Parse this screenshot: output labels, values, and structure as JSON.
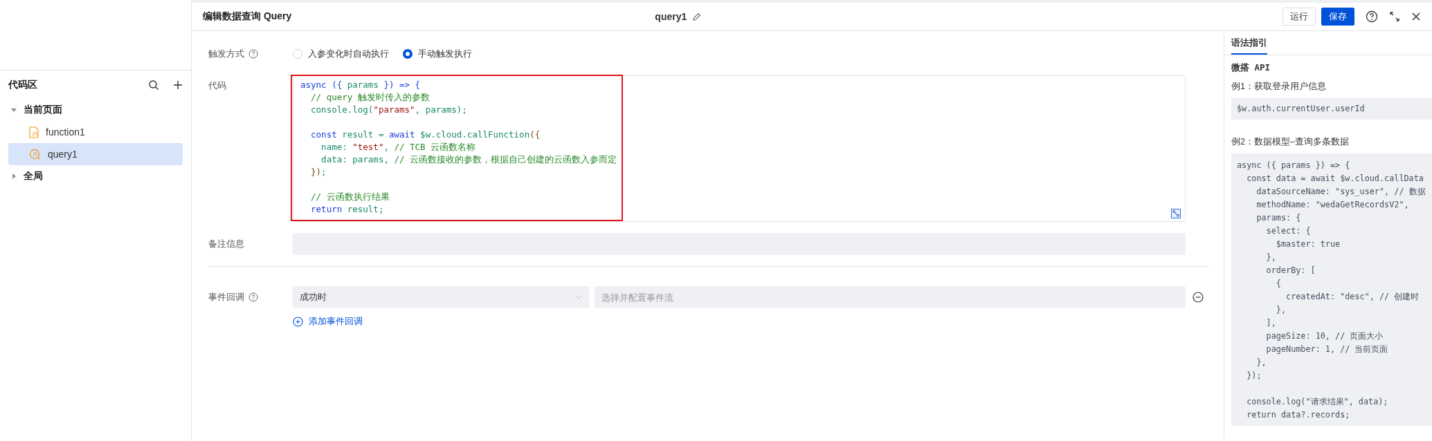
{
  "sidebar": {
    "title": "代码区",
    "tree": [
      {
        "label": "当前页面",
        "kind": "group",
        "expanded": true,
        "selected": false,
        "children": [
          {
            "label": "function1",
            "kind": "function",
            "selected": false
          },
          {
            "label": "query1",
            "kind": "query",
            "selected": true
          }
        ]
      },
      {
        "label": "全局",
        "kind": "group",
        "expanded": false,
        "selected": false
      }
    ]
  },
  "header": {
    "title": "编辑数据查询 Query",
    "name": "query1",
    "buttons": [
      {
        "label": "运行",
        "kind": "default"
      },
      {
        "label": "保存",
        "kind": "primary"
      }
    ]
  },
  "form": {
    "trigger": {
      "label": "触发方式",
      "options": [
        {
          "label": "入参变化时自动执行",
          "selected": false
        },
        {
          "label": "手动触发执行",
          "selected": true
        }
      ]
    },
    "code": {
      "label": "代码",
      "lines": [
        {
          "kind": "code",
          "tokens": [
            {
              "text": "async",
              "kind": "kw"
            },
            {
              "text": " (",
              "kind": "op"
            },
            {
              "text": "{",
              "kind": "op"
            },
            {
              "text": " params ",
              "kind": "var"
            },
            {
              "text": "}) => {",
              "kind": "op"
            }
          ]
        },
        {
          "kind": "code",
          "tokens": [
            {
              "text": "  // query 触发时传入的参数",
              "kind": "cmt"
            }
          ]
        },
        {
          "kind": "code",
          "tokens": [
            {
              "text": "  console.log(",
              "kind": "var"
            },
            {
              "text": "\"params\"",
              "kind": "str"
            },
            {
              "text": ", params);",
              "kind": "var"
            }
          ]
        },
        {
          "kind": "blank"
        },
        {
          "kind": "code",
          "tokens": [
            {
              "text": "  const",
              "kind": "kw"
            },
            {
              "text": " result = ",
              "kind": "var"
            },
            {
              "text": "await",
              "kind": "kw"
            },
            {
              "text": " $w.cloud.callFunction",
              "kind": "var"
            },
            {
              "text": "({",
              "kind": "br"
            }
          ]
        },
        {
          "kind": "code",
          "tokens": [
            {
              "text": "    name: ",
              "kind": "var"
            },
            {
              "text": "\"test\"",
              "kind": "str"
            },
            {
              "text": ", ",
              "kind": "var"
            },
            {
              "text": "// TCB 云函数名称",
              "kind": "cmt"
            }
          ]
        },
        {
          "kind": "code",
          "tokens": [
            {
              "text": "    data: params, ",
              "kind": "var"
            },
            {
              "text": "// 云函数接收的参数，根据自己创建的云函数入参而定",
              "kind": "cmt"
            }
          ]
        },
        {
          "kind": "code",
          "tokens": [
            {
              "text": "  })",
              "kind": "br"
            },
            {
              "text": ";",
              "kind": "var"
            }
          ]
        },
        {
          "kind": "blank"
        },
        {
          "kind": "code",
          "tokens": [
            {
              "text": "  // 云函数执行结果",
              "kind": "cmt"
            }
          ]
        },
        {
          "kind": "code",
          "tokens": [
            {
              "text": "  return",
              "kind": "kw"
            },
            {
              "text": " result;",
              "kind": "var"
            }
          ]
        }
      ]
    },
    "remark": {
      "label": "备注信息"
    },
    "events": {
      "label": "事件回调",
      "rows": [
        {
          "trigger": "成功时",
          "placeholder": "选择并配置事件流"
        }
      ],
      "add": "添加事件回调"
    }
  },
  "guide": {
    "tab": "语法指引",
    "heading": "微搭 API",
    "examples": [
      {
        "title": "例1：获取登录用户信息",
        "lines": [
          {
            "kind": "code",
            "text": "$w.auth.currentUser.userId"
          }
        ]
      },
      {
        "title": "例2：数据模型–查询多条数据",
        "lines": [
          {
            "kind": "code",
            "text": "async ({ params }) => {"
          },
          {
            "kind": "code",
            "text": "  const data = await $w.cloud.callData"
          },
          {
            "kind": "code",
            "text": "    dataSourceName: \"sys_user\", // 数据"
          },
          {
            "kind": "code",
            "text": "    methodName: \"wedaGetRecordsV2\","
          },
          {
            "kind": "code",
            "text": "    params: {"
          },
          {
            "kind": "code",
            "text": "      select: {"
          },
          {
            "kind": "code",
            "text": "        $master: true"
          },
          {
            "kind": "code",
            "text": "      },"
          },
          {
            "kind": "code",
            "text": "      orderBy: ["
          },
          {
            "kind": "code",
            "text": "        {"
          },
          {
            "kind": "code",
            "text": "          createdAt: \"desc\", // 创建时"
          },
          {
            "kind": "code",
            "text": "        },"
          },
          {
            "kind": "code",
            "text": "      ],"
          },
          {
            "kind": "code",
            "text": "      pageSize: 10, // 页面大小"
          },
          {
            "kind": "code",
            "text": "      pageNumber: 1, // 当前页面"
          },
          {
            "kind": "code",
            "text": "    },"
          },
          {
            "kind": "code",
            "text": "  });"
          },
          {
            "kind": "blank"
          },
          {
            "kind": "code",
            "text": "  console.log(\"请求结果\", data);"
          },
          {
            "kind": "code",
            "text": "  return data?.records;"
          }
        ]
      }
    ]
  }
}
